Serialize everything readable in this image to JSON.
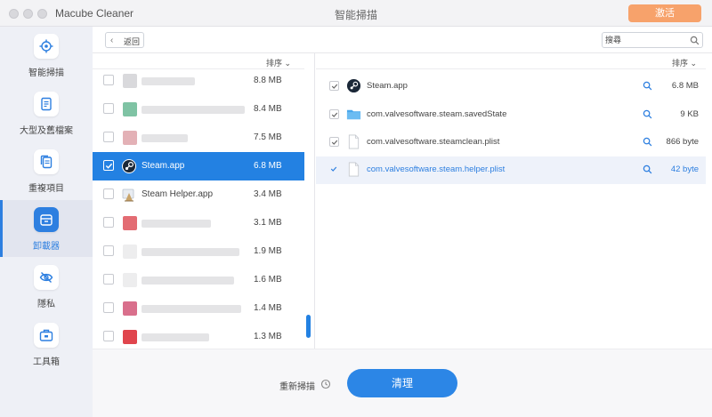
{
  "titlebar": {
    "app_name": "Macube Cleaner",
    "title": "智能掃描",
    "activate_label": "激活"
  },
  "sidebar": {
    "items": [
      {
        "label": "智能掃描",
        "icon": "target-icon",
        "active": false
      },
      {
        "label": "大型及舊檔案",
        "icon": "document-icon",
        "active": false
      },
      {
        "label": "重複項目",
        "icon": "copy-icon",
        "active": false
      },
      {
        "label": "卸載器",
        "icon": "uninstall-icon",
        "active": true
      },
      {
        "label": "隱私",
        "icon": "eye-off-icon",
        "active": false
      },
      {
        "label": "工具箱",
        "icon": "toolbox-icon",
        "active": false
      }
    ]
  },
  "toolbar": {
    "back_label": "返回",
    "search_placeholder": "搜尋"
  },
  "left_list": {
    "sort_label": "排序",
    "rows": [
      {
        "name": "",
        "size": "8.8 MB",
        "selected": false
      },
      {
        "name": "",
        "size": "8.4 MB",
        "selected": false
      },
      {
        "name": "",
        "size": "7.5 MB",
        "selected": false
      },
      {
        "name": "Steam.app",
        "size": "6.8 MB",
        "selected": true
      },
      {
        "name": "Steam Helper.app",
        "size": "3.4 MB",
        "selected": false
      },
      {
        "name": "",
        "size": "3.1 MB",
        "selected": false
      },
      {
        "name": "",
        "size": "1.9 MB",
        "selected": false
      },
      {
        "name": "",
        "size": "1.6 MB",
        "selected": false
      },
      {
        "name": "",
        "size": "1.4 MB",
        "selected": false
      },
      {
        "name": "",
        "size": "1.3 MB",
        "selected": false
      }
    ]
  },
  "right_list": {
    "sort_label": "排序",
    "rows": [
      {
        "name": "Steam.app",
        "size": "6.8 MB",
        "icon": "steam-icon",
        "checked": true
      },
      {
        "name": "com.valvesoftware.steam.savedState",
        "size": "9 KB",
        "icon": "folder-icon",
        "checked": true
      },
      {
        "name": "com.valvesoftware.steamclean.plist",
        "size": "866 byte",
        "icon": "file-icon",
        "checked": true
      },
      {
        "name": "com.valvesoftware.steam.helper.plist",
        "size": "42 byte",
        "icon": "file-icon",
        "checked": true
      }
    ]
  },
  "bottom": {
    "rescan_label": "重新掃描",
    "clean_label": "清理"
  },
  "colors": {
    "accent": "#2381e2",
    "activate": "#f7a26b",
    "sidebar_bg": "#eef0f6"
  }
}
